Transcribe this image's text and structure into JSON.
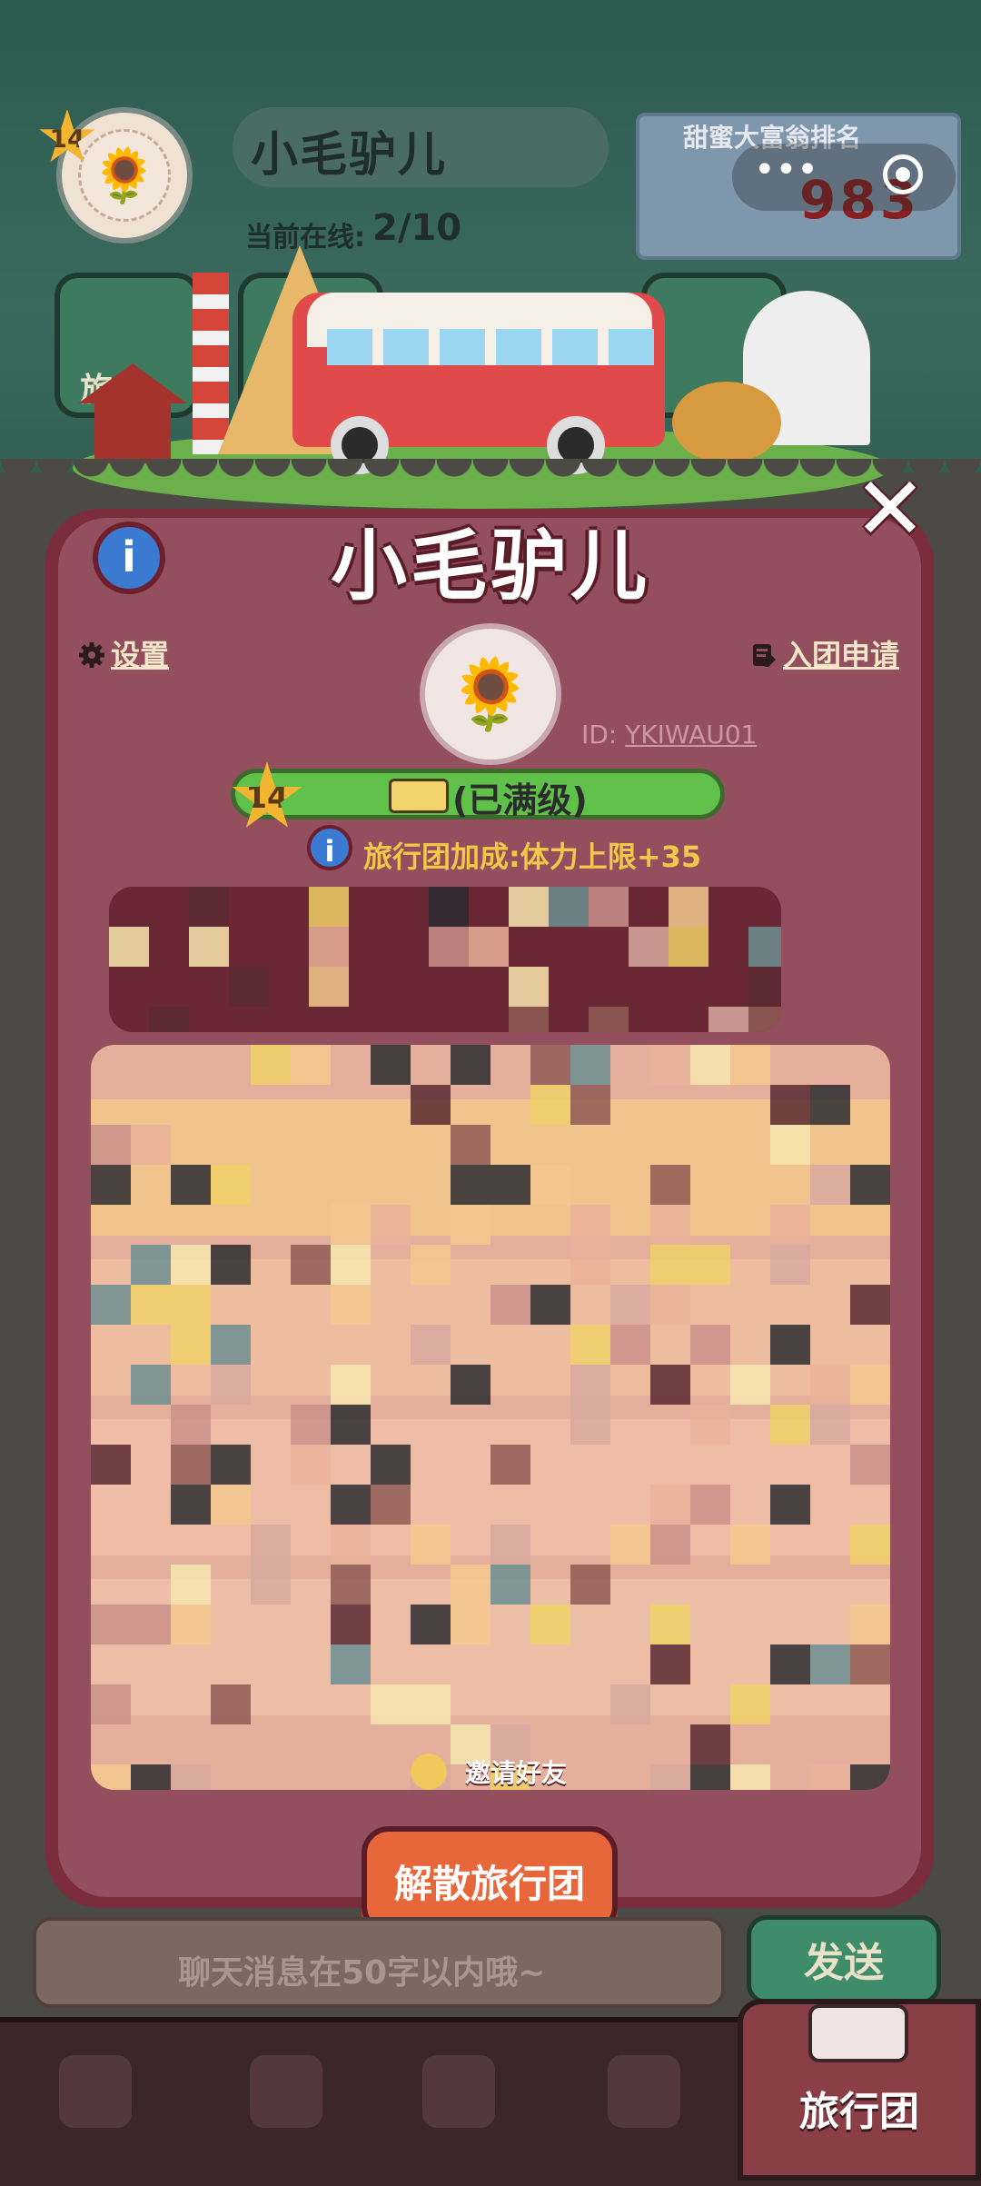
{
  "header": {
    "level": "14",
    "group_name": "小毛驴儿",
    "online_label": "当前在线:",
    "online_count": "2/10"
  },
  "rank_board": {
    "title": "甜蜜大富翁排名",
    "value": "983"
  },
  "capsule": {
    "more": "•••"
  },
  "side_buttons": {
    "travel_label": "旅行"
  },
  "panel": {
    "title": "小毛驴儿",
    "info": "i",
    "close": "✕",
    "settings": "设置",
    "apply": "入团申请",
    "group_id_label": "ID:",
    "group_id": "YKIWAU01",
    "level": "14",
    "level_status": "(已满级)",
    "bonus": "旅行团加成:体力上限+35",
    "invite": "邀请好友",
    "disband": "解散旅行团",
    "avatar_glyph": "🌻"
  },
  "chat": {
    "placeholder": "聊天消息在50字以内哦~",
    "send": "发送"
  },
  "nav": {
    "active_label": "旅行团"
  },
  "colors": {
    "panel": "#944f5e",
    "panel_border": "#7b2d3c",
    "level_bar": "#5fc14a",
    "bonus_text": "#f4c64a",
    "disband": "#e8673a",
    "send": "#3e8c6a",
    "nav": "#3b2628"
  }
}
